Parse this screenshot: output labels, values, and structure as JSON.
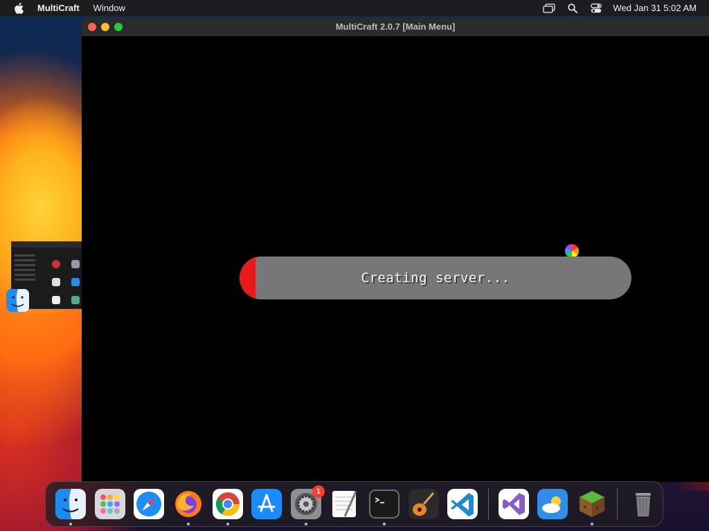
{
  "menubar": {
    "app_name": "MultiCraft",
    "menus": [
      "Window"
    ],
    "clock": "Wed Jan 31  5:02 AM"
  },
  "window": {
    "title": "MultiCraft 2.0.7 [Main Menu]",
    "progress": {
      "label": "Creating server...",
      "fraction": 0.04,
      "fill_color": "#e8191c",
      "track_color": "#777777"
    }
  },
  "dock": {
    "apps": [
      {
        "name": "Finder",
        "running": true
      },
      {
        "name": "Launchpad",
        "running": false
      },
      {
        "name": "Safari",
        "running": false
      },
      {
        "name": "Firefox",
        "running": true
      },
      {
        "name": "Google Chrome",
        "running": true
      },
      {
        "name": "App Store",
        "running": false
      },
      {
        "name": "System Preferences",
        "running": true,
        "badge": "1"
      },
      {
        "name": "TextEdit",
        "running": false
      },
      {
        "name": "Terminal",
        "running": true
      },
      {
        "name": "GarageBand",
        "running": false
      },
      {
        "name": "Visual Studio Code",
        "running": false
      },
      {
        "name": "Visual Studio",
        "running": false
      },
      {
        "name": "Weather",
        "running": false
      },
      {
        "name": "MultiCraft",
        "running": true
      },
      {
        "name": "Trash",
        "running": false
      }
    ]
  }
}
